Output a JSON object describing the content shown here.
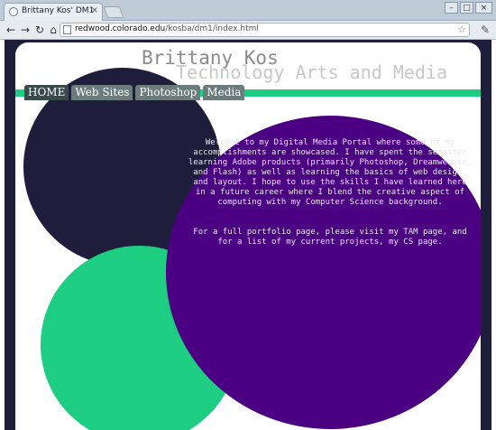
{
  "browser": {
    "tab_title": "Brittany Kos' DM1",
    "url_host": "redwood.colorado.edu",
    "url_path": "/kosba/dm1/index.html"
  },
  "header": {
    "title": "Brittany Kos",
    "subtitle": "Technology Arts and Media"
  },
  "nav": [
    {
      "label": "HOME"
    },
    {
      "label": "Web Sites"
    },
    {
      "label": "Photoshop"
    },
    {
      "label": "Media"
    }
  ],
  "content": {
    "paragraph1": "Welcome to my Digital Media Portal where some of my accomplishments are showcased. I have spent the semester learning Adobe products (primarily Photoshop, Dreamweaver, and Flash) as well as learning the basics of web design. and layout. I hope to use the skills I have learned here in a future career where I blend the creative aspect of computing with my Computer Science background.",
    "paragraph2": "For a full portfolio page, please visit my TAM page, and for a list of my current projects, my CS page."
  },
  "colors": {
    "dark_navy": "#1e1e3c",
    "green": "#1dcd82",
    "purple": "#4b0082",
    "menu_gray": "#6c7b7b"
  }
}
